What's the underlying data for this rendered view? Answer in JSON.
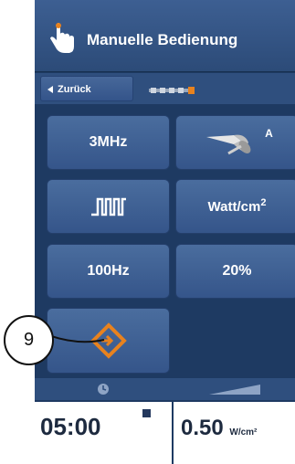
{
  "header": {
    "title": "Manuelle Bedienung",
    "icon": "hand-pointer-icon"
  },
  "nav": {
    "back_label": "Zurück"
  },
  "tiles": {
    "frequency": "3MHz",
    "applicator_label": "A",
    "power_unit": "Watt/cm",
    "power_unit_sup": "2",
    "pulse_frequency": "100Hz",
    "duty_cycle": "20%"
  },
  "callout": {
    "number": "9"
  },
  "status": {
    "timer": "05:00",
    "intensity_value": "0.50",
    "intensity_unit": "W/cm²"
  },
  "colors": {
    "accent": "#e8821e",
    "panel": "#3f6194",
    "background": "#1e3a62"
  }
}
